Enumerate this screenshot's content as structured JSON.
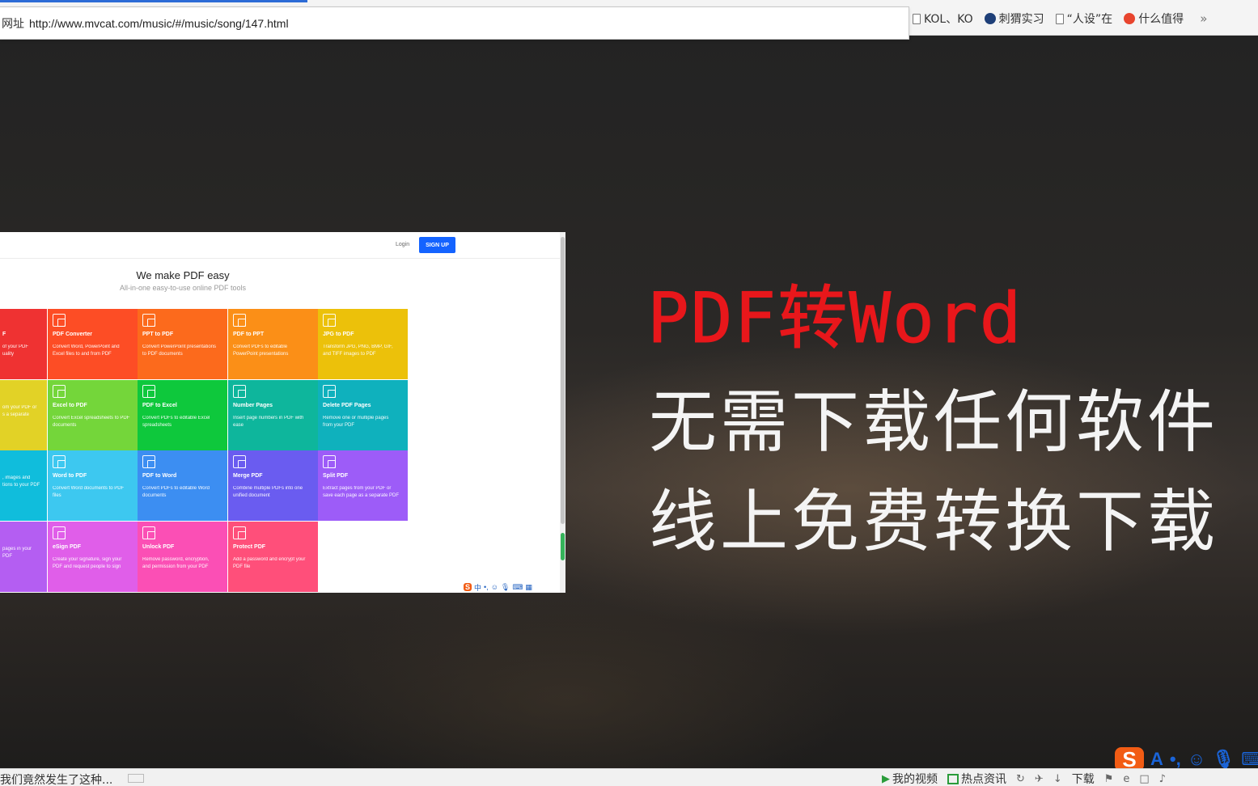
{
  "address_bar": {
    "label": "网址",
    "url": "http://www.mvcat.com/music/#/music/song/147.html"
  },
  "bookmarks": [
    {
      "label": "KOL、KO",
      "icon": "document-icon"
    },
    {
      "label": "刺猬实习",
      "icon": "hedgehog-icon"
    },
    {
      "label": "“人设”在",
      "icon": "document-icon"
    },
    {
      "label": "什么值得",
      "icon": "smzdm-icon"
    }
  ],
  "bookmarks_more": "»",
  "pdf_site": {
    "login": "Login",
    "signup": "SIGN UP",
    "title": "We make PDF easy",
    "subtitle": "All-in-one easy-to-use online PDF tools",
    "tiles": [
      {
        "title": "F",
        "desc": "of your PDF\nuality",
        "color": "#ef3232"
      },
      {
        "title": "PDF Converter",
        "desc": "Convert Word, PowerPoint and\nExcel files to and from PDF",
        "color": "#fd4d25"
      },
      {
        "title": "PPT to PDF",
        "desc": "Convert PowerPoint presentations\nto PDF documents",
        "color": "#fc6a1c"
      },
      {
        "title": "PDF to PPT",
        "desc": "Convert PDFs to editable\nPowerPoint presentations",
        "color": "#fb8f17"
      },
      {
        "title": "JPG to PDF",
        "desc": "Transform JPG, PNG, BMP, GIF,\nand TIFF images to PDF",
        "color": "#ecc10a"
      },
      {
        "title": "",
        "desc": "om your PDF or\ns a separate",
        "color": "#e2d226"
      },
      {
        "title": "Excel to PDF",
        "desc": "Convert Excel spreadsheets to PDF\ndocuments",
        "color": "#74d63a"
      },
      {
        "title": "PDF to Excel",
        "desc": "Convert PDFs to editable Excel\nspreadsheets",
        "color": "#0ec83c"
      },
      {
        "title": "Number Pages",
        "desc": "Insert page numbers in PDF with\nease",
        "color": "#0eb69c"
      },
      {
        "title": "Delete PDF Pages",
        "desc": "Remove one or multiple pages\nfrom your PDF",
        "color": "#0fb1bd"
      },
      {
        "title": "",
        "desc": ", images and\ntions to your PDF",
        "color": "#10bddc"
      },
      {
        "title": "Word to PDF",
        "desc": "Convert Word documents to PDF\nfiles",
        "color": "#3dc8f0"
      },
      {
        "title": "PDF to Word",
        "desc": "Convert PDFs to editable Word\ndocuments",
        "color": "#3c8ef2"
      },
      {
        "title": "Merge PDF",
        "desc": "Combine multiple PDFs into one\nunified document",
        "color": "#6a5cf0"
      },
      {
        "title": "Split PDF",
        "desc": "Extract pages from your PDF or\nsave each page as a separate PDF",
        "color": "#9d5cf8"
      },
      {
        "title": "",
        "desc": "pages in your PDF",
        "color": "#b45ef2"
      },
      {
        "title": "eSign PDF",
        "desc": "Create your signature, sign your\nPDF and request people to sign",
        "color": "#e05ee9"
      },
      {
        "title": "Unlock PDF",
        "desc": "Remove password, encryption,\nand permission from your PDF",
        "color": "#fb4fb5"
      },
      {
        "title": "Protect PDF",
        "desc": "Add a password and encrypt your\nPDF file",
        "color": "#ff4f7a"
      }
    ],
    "ime_mini": {
      "logo": "S",
      "mode": "中"
    }
  },
  "promo": {
    "title": "PDF转Word",
    "line1": "无需下载任何软件",
    "line2": "线上免费转换下载"
  },
  "ime_toolbar": {
    "logo": "S",
    "mode": "A"
  },
  "status": {
    "news": "我们竟然发生了这种...",
    "items": [
      "我的视频",
      "热点资讯",
      "下载"
    ]
  }
}
